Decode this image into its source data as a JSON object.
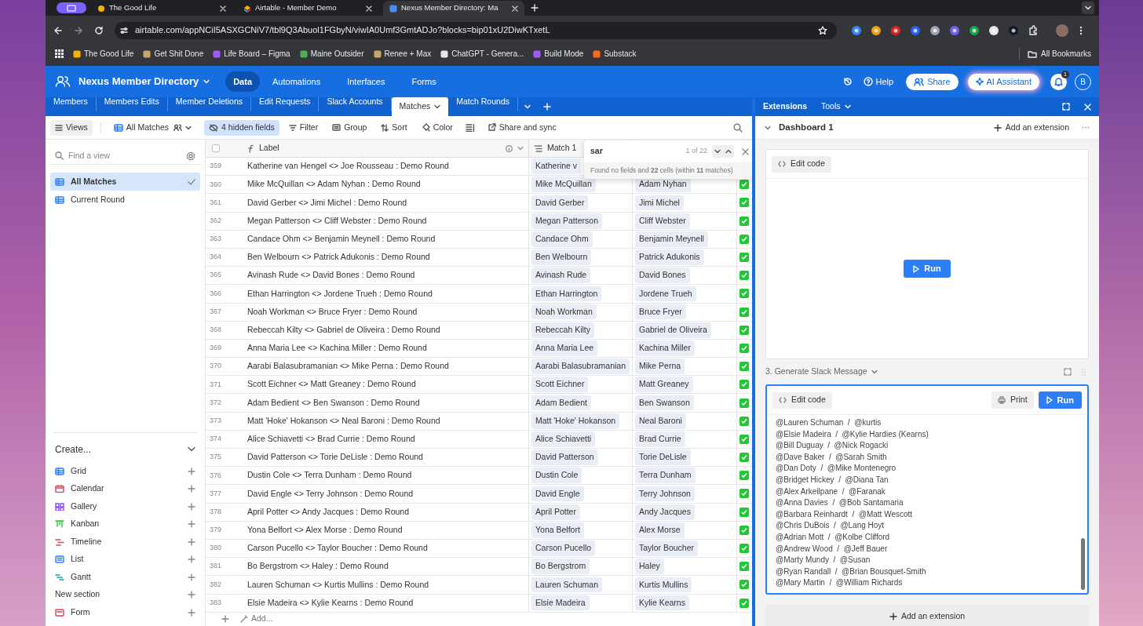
{
  "browser": {
    "tabs": [
      {
        "title": "The Good Life",
        "selected": false
      },
      {
        "title": "Airtable - Member Demo",
        "selected": false
      },
      {
        "title": "Nexus Member Directory: Ma",
        "selected": true
      }
    ],
    "url": "airtable.com/appNCiI5ASXGCNiV7/tbl9Q3Abuol1FGbyN/viwIA0Umf3GmtADJo?blocks=bip01xU2DiwKTxetL",
    "bookmarks": [
      "The Good Life",
      "Get Shit Done",
      "Life Board – Figma",
      "Maine Outsider",
      "Renee + Max",
      "ChatGPT - Genera...",
      "Build Mode",
      "Substack"
    ],
    "all_bookmarks": "All Bookmarks"
  },
  "app": {
    "title": "Nexus Member Directory",
    "nav": [
      {
        "label": "Data",
        "selected": true
      },
      {
        "label": "Automations",
        "selected": false
      },
      {
        "label": "Interfaces",
        "selected": false
      },
      {
        "label": "Forms",
        "selected": false
      }
    ],
    "help": "Help",
    "share": "Share",
    "ai_assistant": "AI Assistant",
    "notification_count": "1",
    "user_initial": "B"
  },
  "table_tabs": [
    {
      "label": "Members",
      "selected": false
    },
    {
      "label": "Members Edits",
      "selected": false
    },
    {
      "label": "Member Deletions",
      "selected": false
    },
    {
      "label": "Edit Requests",
      "selected": false
    },
    {
      "label": "Slack Accounts",
      "selected": false
    },
    {
      "label": "Matches",
      "selected": true
    },
    {
      "label": "Match Rounds",
      "selected": false
    }
  ],
  "toolbar": {
    "views": "Views",
    "current_view": "All Matches",
    "hidden_fields": "4 hidden fields",
    "filter": "Filter",
    "group": "Group",
    "sort": "Sort",
    "color_button": "Color",
    "share_sync": "Share and sync"
  },
  "sidebar": {
    "find_placeholder": "Find a view",
    "views": [
      {
        "label": "All Matches",
        "selected": true
      },
      {
        "label": "Current Round",
        "selected": false
      }
    ],
    "create_title": "Create...",
    "create_items": [
      {
        "kind": "grid",
        "label": "Grid"
      },
      {
        "kind": "calendar",
        "label": "Calendar"
      },
      {
        "kind": "gallery",
        "label": "Gallery"
      },
      {
        "kind": "kanban",
        "label": "Kanban"
      },
      {
        "kind": "timeline",
        "label": "Timeline"
      },
      {
        "kind": "list",
        "label": "List"
      },
      {
        "kind": "gantt",
        "label": "Gantt"
      },
      {
        "kind": "section",
        "label": "New section"
      },
      {
        "kind": "form",
        "label": "Form"
      }
    ]
  },
  "table": {
    "columns": [
      "Label",
      "Match 1"
    ],
    "rows": [
      {
        "number": "359",
        "label": "Katherine van Hengel <> Joe Rousseau : Demo Round",
        "match_1": "Katherine v"
      },
      {
        "number": "360",
        "label": "Mike McQuillan <> Adam Nyhan : Demo Round",
        "match_1": "Mike McQuillan",
        "match_2": "Adam Nyhan",
        "checked": true
      },
      {
        "number": "361",
        "label": "David Gerber <> Jimi Michel : Demo Round",
        "match_1": "David Gerber",
        "match_2": "Jimi Michel",
        "checked": true
      },
      {
        "number": "362",
        "label": "Megan Patterson <> Cliff Webster : Demo Round",
        "match_1": "Megan Patterson",
        "match_2": "Cliff Webster",
        "checked": true
      },
      {
        "number": "363",
        "label": "Candace Ohm <> Benjamin Meynell : Demo Round",
        "match_1": "Candace Ohm",
        "match_2": "Benjamin Meynell",
        "checked": true
      },
      {
        "number": "364",
        "label": "Ben Welbourn <> Patrick Adukonis : Demo Round",
        "match_1": "Ben Welbourn",
        "match_2": "Patrick Adukonis",
        "checked": true
      },
      {
        "number": "365",
        "label": "Avinash Rude <> David Bones : Demo Round",
        "match_1": "Avinash Rude",
        "match_2": "David Bones",
        "checked": true
      },
      {
        "number": "366",
        "label": "Ethan Harrington <> Jordene Trueh : Demo Round",
        "match_1": "Ethan Harrington",
        "match_2": "Jordene Trueh",
        "checked": true
      },
      {
        "number": "367",
        "label": "Noah Workman <> Bruce Fryer : Demo Round",
        "match_1": "Noah Workman",
        "match_2": "Bruce Fryer",
        "checked": true
      },
      {
        "number": "368",
        "label": "Rebeccah Kilty <> Gabriel de Oliveira : Demo Round",
        "match_1": "Rebeccah Kilty",
        "match_2": "Gabriel de Oliveira",
        "checked": true
      },
      {
        "number": "369",
        "label": "Anna Maria Lee <> Kachina Miller : Demo Round",
        "match_1": "Anna Maria Lee",
        "match_2": "Kachina Miller",
        "checked": true
      },
      {
        "number": "370",
        "label": "Aarabi Balasubramanian <> Mike Perna : Demo Round",
        "match_1": "Aarabi Balasubramanian",
        "match_2": "Mike Perna",
        "checked": true
      },
      {
        "number": "371",
        "label": "Scott Eichner <> Matt Greaney : Demo Round",
        "match_1": "Scott Eichner",
        "match_2": "Matt Greaney",
        "checked": true
      },
      {
        "number": "372",
        "label": "Adam Bedient <> Ben Swanson : Demo Round",
        "match_1": "Adam Bedient",
        "match_2": "Ben Swanson",
        "checked": true
      },
      {
        "number": "373",
        "label": "Matt 'Hoke' Hokanson <> Neal Baroni : Demo Round",
        "match_1": "Matt 'Hoke' Hokanson",
        "match_2": "Neal Baroni",
        "checked": true
      },
      {
        "number": "374",
        "label": "Alice Schiavetti <> Brad Currie : Demo Round",
        "match_1": "Alice Schiavetti",
        "match_2": "Brad Currie",
        "checked": true
      },
      {
        "number": "375",
        "label": "David Patterson <> Torie DeLisle : Demo Round",
        "match_1": "David Patterson",
        "match_2": "Torie DeLisle",
        "checked": true
      },
      {
        "number": "376",
        "label": "Dustin Cole <> Terra Dunham : Demo Round",
        "match_1": "Dustin Cole",
        "match_2": "Terra Dunham",
        "checked": true
      },
      {
        "number": "377",
        "label": "David Engle <> Terry Johnson : Demo Round",
        "match_1": "David Engle",
        "match_2": "Terry Johnson",
        "checked": true
      },
      {
        "number": "378",
        "label": "April Potter <> Andy Jacques : Demo Round",
        "match_1": "April Potter",
        "match_2": "Andy Jacques",
        "checked": true
      },
      {
        "number": "379",
        "label": "Yona Belfort <> Alex Morse : Demo Round",
        "match_1": "Yona Belfort",
        "match_2": "Alex Morse",
        "checked": true
      },
      {
        "number": "380",
        "label": "Carson Pucello <> Taylor Boucher : Demo Round",
        "match_1": "Carson Pucello",
        "match_2": "Taylor Boucher",
        "checked": true
      },
      {
        "number": "381",
        "label": "Bo Bergstrom <> Haley : Demo Round",
        "match_1": "Bo Bergstrom",
        "match_2": "Haley",
        "checked": true
      },
      {
        "number": "382",
        "label": "Lauren Schuman <> Kurtis Mullins : Demo Round",
        "match_1": "Lauren Schuman",
        "match_2": "Kurtis Mullins",
        "checked": true
      },
      {
        "number": "383",
        "label": "Elsie Madeira <> Kylie Kearns : Demo Round",
        "match_1": "Elsie Madeira",
        "match_2": "Kylie Kearns",
        "checked": true
      }
    ],
    "add_row": "Add..."
  },
  "search": {
    "value": "sar",
    "count": "1 of 22",
    "result": "Found no fields and **22** cells (within **11** matches)"
  },
  "extensions": {
    "tabs": [
      "Extensions",
      "Tools"
    ],
    "dashboard": "Dashboard 1",
    "add_extension": "Add an extension",
    "blocks": [
      {
        "edit_code": "Edit code",
        "run": "Run"
      },
      {
        "title": "3. Generate Slack Message",
        "edit_code": "Edit code",
        "print": "Print",
        "run": "Run",
        "output": [
          "@Lauren Schuman  /  @kurtis",
          "@Elsie Madeira  /  @Kylie Hardies (Kearns)",
          "@Bill Duguay  /  @Nick Rogacki",
          "@Dave Baker  /  @Sarah Smith",
          "@Dan Doty  /  @Mike Montenegro",
          "@Bridget Hickey  /  @Diana Tan",
          "@Alex Arkeilpane  /  @Faranak",
          "@Anna Davies  /  @Bob Santamaria",
          "@Barbara Reinhardt  /  @Matt Wescott",
          "@Chris DuBois  /  @Lang Hoyt",
          "@Adrian Mott  /  @Kolbe Clifford",
          "@Andrew Wood  /  @Jeff Bauer",
          "@Marty Mundy  /  @Susan",
          "@Ryan Randall  /  @Brian Bousquet-Smith",
          "@Mary Martin  /  @William Richards"
        ]
      }
    ],
    "add_extension_bottom": "Add an extension"
  }
}
